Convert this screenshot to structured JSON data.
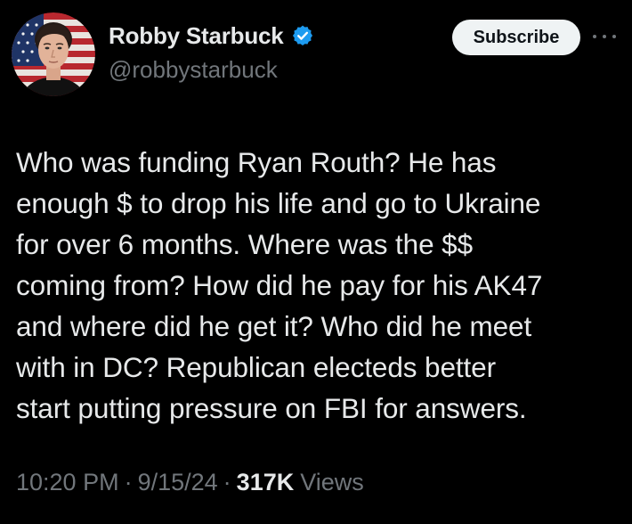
{
  "author": {
    "display_name": "Robby Starbuck",
    "handle": "@robbystarbuck",
    "verified_icon": "verified-badge-icon",
    "verified_color": "#1d9bf0"
  },
  "actions": {
    "subscribe_label": "Subscribe",
    "more_icon": "more-horizontal-icon"
  },
  "tweet": {
    "text": "Who was funding Ryan Routh? He has\nenough $ to drop his life and go to Ukraine\nfor over 6 months. Where was the $$\ncoming from? How did he pay for his AK47\nand where did he get it? Who did he meet\nwith in DC? Republican electeds better\nstart putting pressure on FBI for answers.",
    "time": "10:20 PM",
    "date": "9/15/24",
    "separator": "·",
    "views_count": "317K",
    "views_label": "Views"
  },
  "colors": {
    "background": "#000000",
    "primary_text": "#e7e9ea",
    "secondary_text": "#71767b",
    "button_bg": "#eff3f4",
    "button_text": "#0f1419"
  }
}
